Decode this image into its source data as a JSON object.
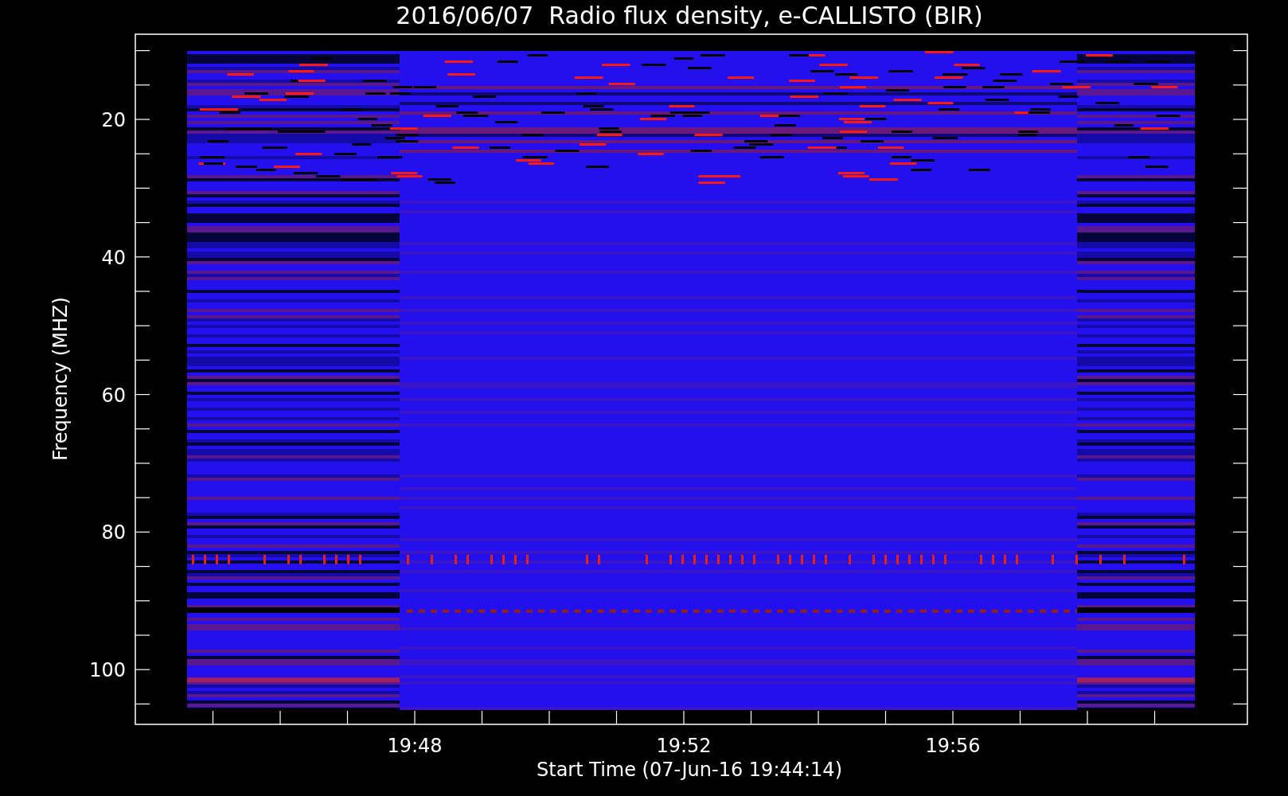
{
  "title": "2016/06/07  Radio flux density, e-CALLISTO (BIR)",
  "y_axis": {
    "label": "Frequency (MHZ)",
    "ticks": [
      "20",
      "40",
      "60",
      "80",
      "100"
    ]
  },
  "x_axis": {
    "label": "Start Time (07-Jun-16 19:44:14)",
    "ticks": [
      "19:48",
      "19:52",
      "19:56"
    ]
  }
}
